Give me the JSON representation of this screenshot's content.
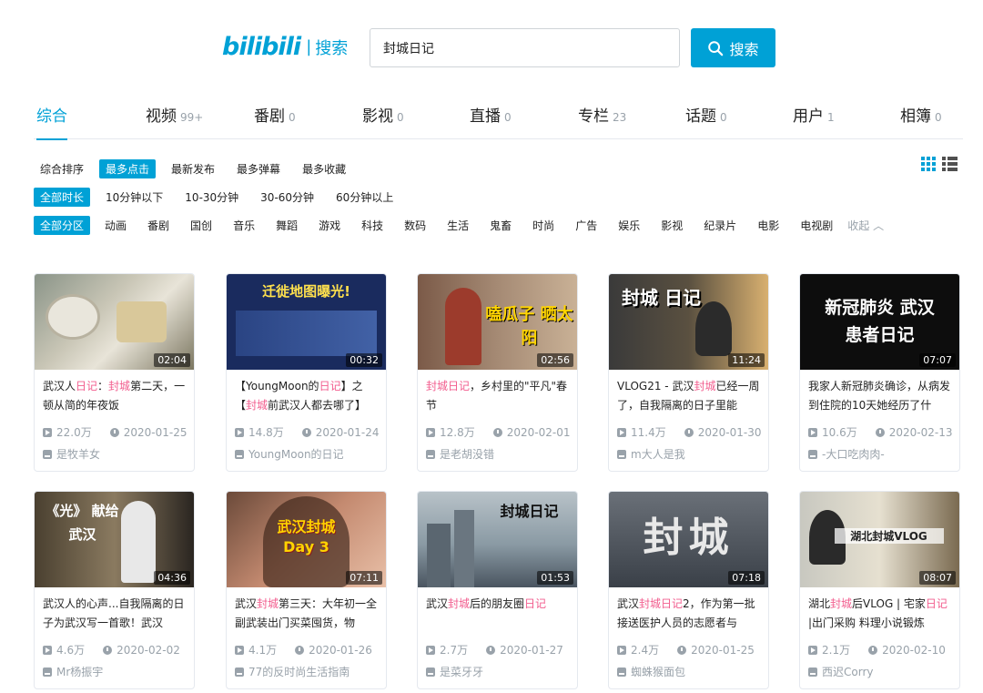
{
  "header": {
    "logo_mark": "bilibili",
    "logo_sep": "|",
    "logo_text": "搜索",
    "search_value": "封城日记",
    "search_button": "搜索"
  },
  "type_tabs": [
    {
      "label": "综合",
      "count": ""
    },
    {
      "label": "视频",
      "count": "99+"
    },
    {
      "label": "番剧",
      "count": "0"
    },
    {
      "label": "影视",
      "count": "0"
    },
    {
      "label": "直播",
      "count": "0"
    },
    {
      "label": "专栏",
      "count": "23"
    },
    {
      "label": "话题",
      "count": "0"
    },
    {
      "label": "用户",
      "count": "1"
    },
    {
      "label": "相簿",
      "count": "0"
    }
  ],
  "sort_filters": [
    "综合排序",
    "最多点击",
    "最新发布",
    "最多弹幕",
    "最多收藏"
  ],
  "duration_filters": [
    "全部时长",
    "10分钟以下",
    "10-30分钟",
    "30-60分钟",
    "60分钟以上"
  ],
  "zone_filters": [
    "全部分区",
    "动画",
    "番剧",
    "国创",
    "音乐",
    "舞蹈",
    "游戏",
    "科技",
    "数码",
    "生活",
    "鬼畜",
    "时尚",
    "广告",
    "娱乐",
    "影视",
    "纪录片",
    "电影",
    "电视剧"
  ],
  "zone_collapse": "收起",
  "videos": [
    {
      "title_parts": [
        "武汉人",
        "日记",
        "：",
        "封城",
        "第二天，一顿从简的年夜饭"
      ],
      "duration": "02:04",
      "views": "22.0万",
      "date": "2020-01-25",
      "uploader": "是牧羊女",
      "thumb_text": ""
    },
    {
      "title_parts": [
        "【YoungMoon的",
        "日记",
        "】之【",
        "封城",
        "前武汉人都去哪了】"
      ],
      "duration": "00:32",
      "views": "14.8万",
      "date": "2020-01-24",
      "uploader": "YoungMoon的日记",
      "thumb_text": "迁徙地图曝光!"
    },
    {
      "title_parts": [
        "",
        "封城日记",
        "，乡村里的\"平凡\"春节",
        "",
        ""
      ],
      "duration": "02:56",
      "views": "12.8万",
      "date": "2020-02-01",
      "uploader": "是老胡没错",
      "thumb_text": "嗑瓜子 晒太阳"
    },
    {
      "title_parts": [
        "VLOG21 - 武汉",
        "封城",
        "已经一周了，自我隔离的日子里能",
        "",
        ""
      ],
      "duration": "11:24",
      "views": "11.4万",
      "date": "2020-01-30",
      "uploader": "m大人是我",
      "thumb_text": "封城 日记"
    },
    {
      "title_parts": [
        "我家人新冠肺炎确诊，从病发到住院的10天她经历了什",
        "",
        "",
        "",
        ""
      ],
      "duration": "07:07",
      "views": "10.6万",
      "date": "2020-02-13",
      "uploader": "-大口吃肉肉-",
      "thumb_text": "新冠肺炎 武汉患者日记"
    },
    {
      "title_parts": [
        "武汉人的心声...自我隔离的日子为武汉写一首歌！武汉",
        "",
        "",
        "",
        ""
      ],
      "duration": "04:36",
      "views": "4.6万",
      "date": "2020-02-02",
      "uploader": "Mr杨振宇",
      "thumb_text": "《光》 献给 武汉"
    },
    {
      "title_parts": [
        "武汉",
        "封城",
        "第三天：大年初一全副武装出门买菜囤货，物",
        "",
        ""
      ],
      "duration": "07:11",
      "views": "4.1万",
      "date": "2020-01-26",
      "uploader": "77的反时尚生活指南",
      "thumb_text": "武汉封城 Day 3"
    },
    {
      "title_parts": [
        "武汉",
        "封城",
        "后的朋友圈",
        "日记",
        ""
      ],
      "duration": "01:53",
      "views": "2.7万",
      "date": "2020-01-27",
      "uploader": "是菜牙牙",
      "thumb_text": "封城日记"
    },
    {
      "title_parts": [
        "武汉",
        "封城日记",
        "2，作为第一批接送医护人员的志愿者与",
        "",
        ""
      ],
      "duration": "07:18",
      "views": "2.4万",
      "date": "2020-01-25",
      "uploader": "蜘蛛猴面包",
      "thumb_text": "封城"
    },
    {
      "title_parts": [
        "湖北",
        "封城",
        "后VLOG | 宅家",
        "日记",
        " |出门采购 料理小说锻炼"
      ],
      "duration": "08:07",
      "views": "2.1万",
      "date": "2020-02-10",
      "uploader": "西迟Corry",
      "thumb_text": "湖北封城VLOG"
    }
  ],
  "colors": {
    "accent": "#00a1d6",
    "highlight": "#f25d8e",
    "muted": "#99a2aa"
  }
}
